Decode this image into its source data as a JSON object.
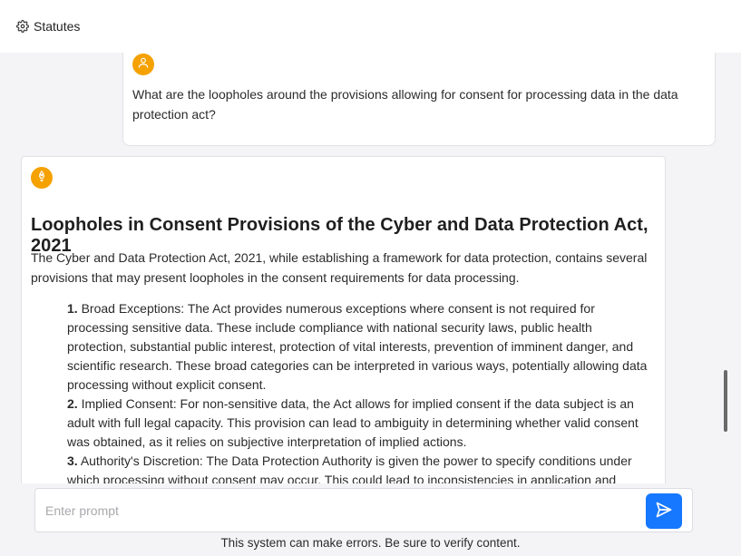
{
  "header": {
    "statutes_label": "Statutes",
    "statutes_icon": "gear-icon"
  },
  "conversation": {
    "user_message": {
      "avatar_icon": "user-icon",
      "text": "What are the loopholes around the provisions allowing for consent for processing data in the data protection act?"
    },
    "assistant_message": {
      "avatar_icon": "bot-icon",
      "title": "Loopholes in Consent Provisions of the Cyber and Data Protection Act, 2021",
      "intro": "The Cyber and Data Protection Act, 2021, while establishing a framework for data protection, contains several provisions that may present loopholes in the consent requirements for data processing.",
      "points": [
        {
          "number": "1.",
          "text": "Broad Exceptions: The Act provides numerous exceptions where consent is not required for processing sensitive data. These include compliance with national security laws, public health protection, substantial public interest, protection of vital interests, prevention of imminent danger, and scientific research. These broad categories can be interpreted in various ways, potentially allowing data processing without explicit consent."
        },
        {
          "number": "2.",
          "text": "Implied Consent: For non-sensitive data, the Act allows for implied consent if the data subject is an adult with full legal capacity. This provision can lead to ambiguity in determining whether valid consent was obtained, as it relies on subjective interpretation of implied actions."
        },
        {
          "number": "3.",
          "text": "Authority's Discretion: The Data Protection Authority is given the power to specify conditions under which processing without consent may occur. This could lead to inconsistencies in application and"
        }
      ]
    }
  },
  "prompt": {
    "placeholder": "Enter prompt",
    "value": "",
    "send_icon": "send-icon"
  },
  "footer": {
    "disclaimer": "This system can make errors. Be sure to verify content."
  },
  "colors": {
    "avatar": "#f5a100",
    "send_button": "#1677ff",
    "background": "#f4f4f6"
  }
}
